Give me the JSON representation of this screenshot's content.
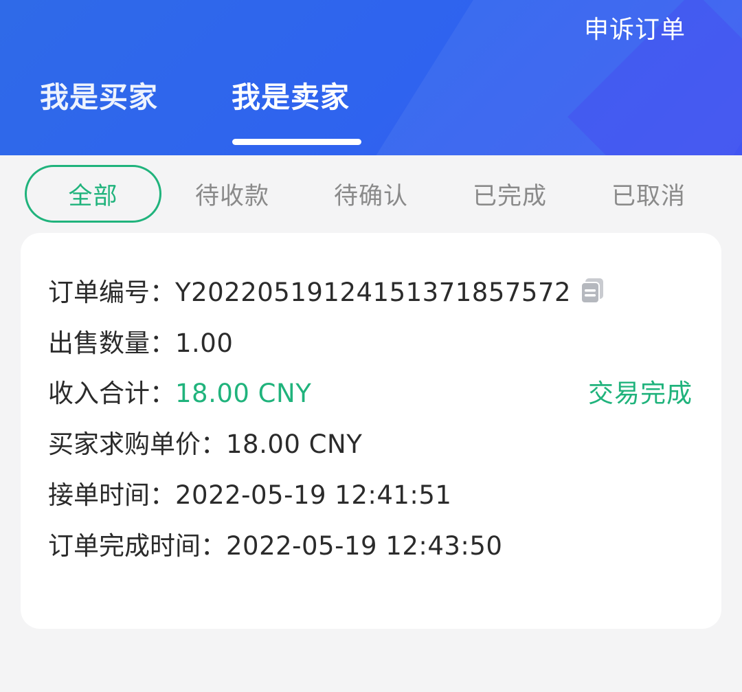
{
  "header": {
    "appeal_label": "申诉订单",
    "tabs": [
      "我是买家",
      "我是卖家"
    ],
    "active_tab": "我是卖家"
  },
  "filters": {
    "items": [
      "全部",
      "待收款",
      "待确认",
      "已完成",
      "已取消"
    ],
    "active": "全部"
  },
  "order": {
    "order_no_label": "订单编号：",
    "order_no": "Y2022051912415137185 7572",
    "qty_label": "出售数量：",
    "qty": "1.00",
    "income_label": "收入合计：",
    "income": "18.00 CNY",
    "status": "交易完成",
    "unit_price_label": "买家求购单价：",
    "unit_price": "18.00 CNY",
    "accept_time_label": "接单时间：",
    "accept_time": "2022-05-19 12:41:51",
    "complete_time_label": "订单完成时间：",
    "complete_time": "2022-05-19 12:43:50"
  },
  "colors": {
    "header_blue": "#2f6ae8",
    "accent_green": "#20b37c",
    "text_dark": "#2b2b2b",
    "text_muted": "#8a8a8a",
    "background": "#f4f4f5"
  },
  "icons": {
    "copy": "copy-icon"
  }
}
